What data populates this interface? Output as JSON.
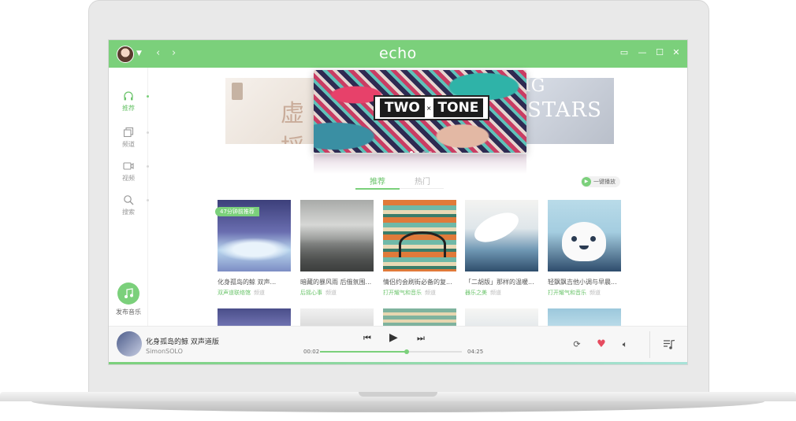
{
  "app": {
    "logo": "echo"
  },
  "sidebar": {
    "items": [
      {
        "label": "推荐",
        "icon": "headphones-icon"
      },
      {
        "label": "频道",
        "icon": "channel-icon"
      },
      {
        "label": "视频",
        "icon": "video-icon"
      },
      {
        "label": "搜索",
        "icon": "search-icon"
      }
    ],
    "publish_label": "发布音乐"
  },
  "banner": {
    "left_text": "虚捋",
    "main_text_1": "TWO",
    "main_text_x": "×",
    "main_text_2": "TONE",
    "right_text_1": "IG",
    "right_text_2": "STARS"
  },
  "tabs": [
    {
      "label": "推荐"
    },
    {
      "label": "热门"
    }
  ],
  "play_all_label": "一键播放",
  "badge": "47分钟前推荐",
  "cards": [
    {
      "title": "化身孤岛的鲸 双声...",
      "tag": "双声道联络馆",
      "tag2": "频道"
    },
    {
      "title": "暗藏的暴风雨 后俄氛围...",
      "tag": "后摇心事",
      "tag2": "频道"
    },
    {
      "title": "情侣约会刷街必备的复...",
      "tag": "打开耀气和音乐",
      "tag2": "频道"
    },
    {
      "title": "「二胡版」那样的温暖...",
      "tag": "器乐之美",
      "tag2": "频道"
    },
    {
      "title": "轻飘飘吉他小调与早晨...",
      "tag": "打开耀气和音乐",
      "tag2": "频道"
    }
  ],
  "player": {
    "title": "化身孤岛的鲸 双声道版",
    "artist": "SimonSOLO",
    "current_time": "00:02",
    "total_time": "04:25",
    "progress": 0.61
  },
  "colors": {
    "accent": "#7bd07b",
    "heart": "#e64b5f"
  }
}
